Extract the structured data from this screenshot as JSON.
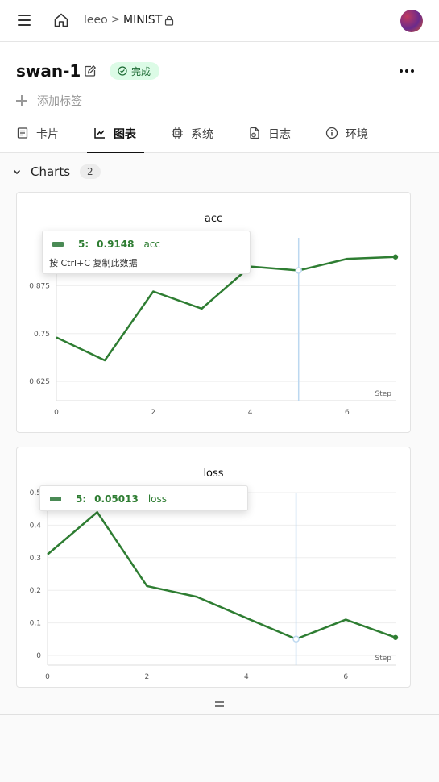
{
  "breadcrumb": {
    "user": "leeo",
    "separator": ">",
    "project": "MINIST"
  },
  "run": {
    "name": "swan-1",
    "status": "完成",
    "add_tag": "添加标签"
  },
  "tabs": [
    {
      "id": "card",
      "label": "卡片",
      "icon": "card-icon"
    },
    {
      "id": "charts",
      "label": "图表",
      "icon": "chart-icon",
      "active": true
    },
    {
      "id": "system",
      "label": "系统",
      "icon": "cpu-icon"
    },
    {
      "id": "logs",
      "label": "日志",
      "icon": "log-icon"
    },
    {
      "id": "env",
      "label": "环境",
      "icon": "info-icon"
    }
  ],
  "group": {
    "title": "Charts",
    "count": "2"
  },
  "colors": {
    "series": "#2e7d32",
    "crosshair": "#bcd8f0",
    "status_bg": "#dcfbe6"
  },
  "tooltips": [
    {
      "step": "5:",
      "value": "0.9148",
      "metric": "acc",
      "hint": "按 Ctrl+C 复制此数据"
    },
    {
      "step": "5:",
      "value": "0.05013",
      "metric": "loss"
    }
  ],
  "chart_data": [
    {
      "type": "line",
      "title": "acc",
      "xlabel": "Step",
      "x": [
        0,
        1,
        2,
        3,
        4,
        5,
        6,
        7
      ],
      "series": [
        {
          "name": "acc",
          "values": [
            0.74,
            0.68,
            0.86,
            0.815,
            0.925,
            0.9148,
            0.945,
            0.95
          ]
        }
      ],
      "xlim": [
        0,
        7
      ],
      "ylim": [
        0.6,
        1.0
      ],
      "yticks": [
        0.625,
        0.75,
        0.875
      ],
      "ytick_labels": [
        "0.625",
        "0.75",
        "0.875"
      ],
      "xticks": [
        0,
        2,
        4,
        6
      ],
      "highlight_x": 5
    },
    {
      "type": "line",
      "title": "loss",
      "xlabel": "Step",
      "x": [
        0,
        1,
        2,
        3,
        4,
        5,
        6,
        7
      ],
      "series": [
        {
          "name": "loss",
          "values": [
            0.31,
            0.44,
            0.213,
            0.18,
            0.115,
            0.05013,
            0.11,
            0.055
          ]
        }
      ],
      "xlim": [
        0,
        7
      ],
      "ylim": [
        0,
        0.5
      ],
      "yticks": [
        0,
        0.1,
        0.2,
        0.3,
        0.4,
        0.5
      ],
      "ytick_labels": [
        "0",
        "0.1",
        "0.2",
        "0.3",
        "0.4",
        "0.5"
      ],
      "xticks": [
        0,
        2,
        4,
        6
      ],
      "highlight_x": 5
    }
  ]
}
